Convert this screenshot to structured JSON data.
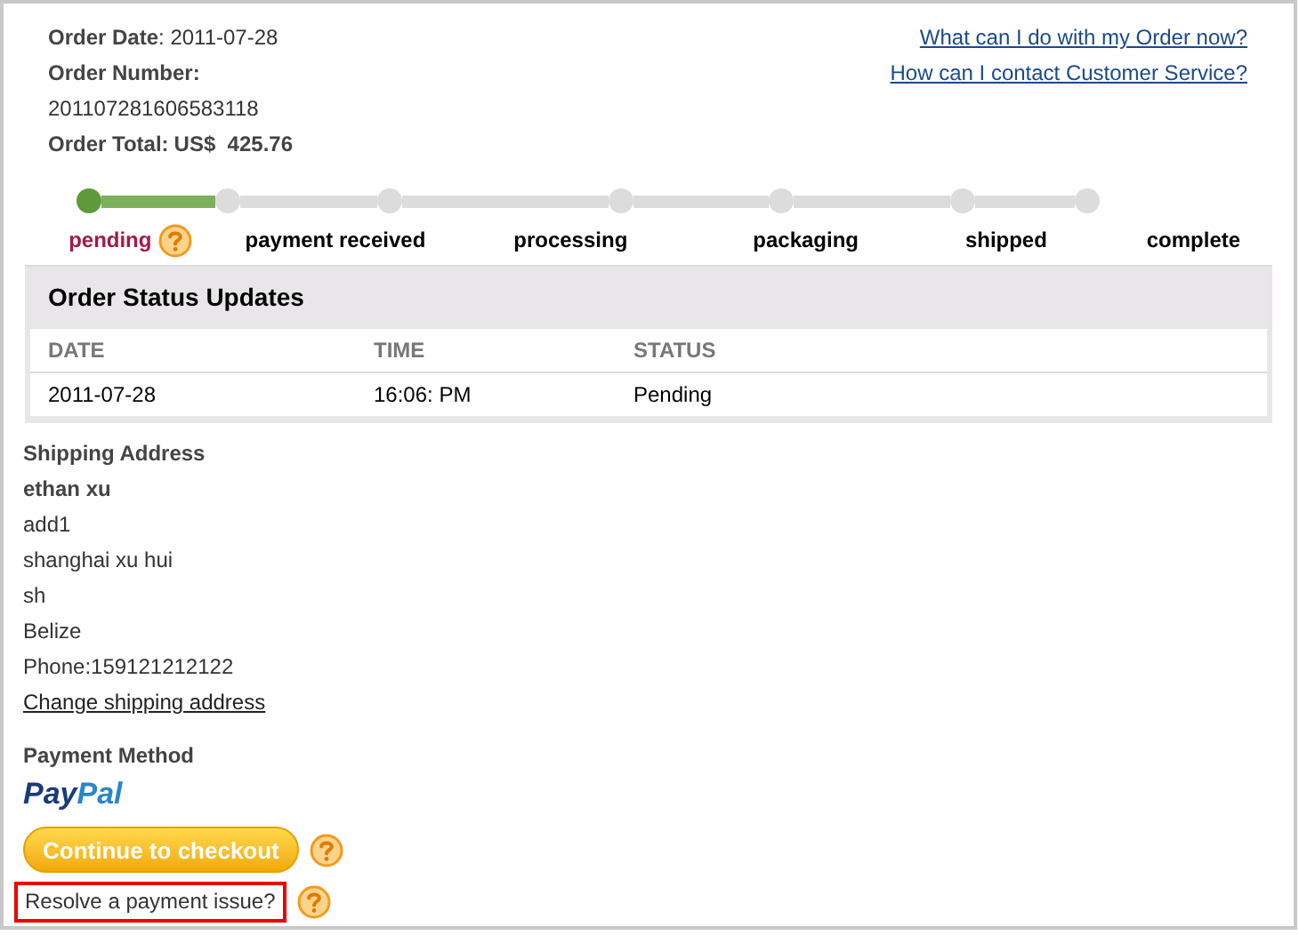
{
  "order": {
    "date_label": "Order Date",
    "date": ": 2011-07-28",
    "number_label": "Order Number:",
    "number": "201107281606583118",
    "total_label": "Order Total:",
    "total": "US$  425.76"
  },
  "links": [
    "What can I do with my Order now?",
    "How can I contact Customer Service?"
  ],
  "progress": {
    "nodes": [
      {
        "reached": true
      },
      {
        "reached": false
      },
      {
        "reached": false
      },
      {
        "reached": false
      },
      {
        "reached": false
      },
      {
        "reached": false
      },
      {
        "reached": false
      }
    ],
    "labels": [
      {
        "text": "pending",
        "current": true,
        "help": true
      },
      {
        "text": "payment received",
        "current": false,
        "help": false
      },
      {
        "text": "processing",
        "current": false,
        "help": false
      },
      {
        "text": "packaging",
        "current": false,
        "help": false
      },
      {
        "text": "shipped",
        "current": false,
        "help": false
      },
      {
        "text": "complete",
        "current": false,
        "help": false
      }
    ]
  },
  "status_updates": {
    "title": "Order Status Updates",
    "columns": [
      "DATE",
      "TIME",
      "STATUS"
    ],
    "rows": [
      [
        "2011-07-28",
        "16:06: PM",
        "Pending"
      ]
    ]
  },
  "shipping": {
    "title": "Shipping Address",
    "name": "ethan xu",
    "lines": [
      "add1",
      "shanghai xu hui",
      "sh",
      "Belize",
      "Phone:159121212122"
    ],
    "change_link": "Change shipping address"
  },
  "payment": {
    "title": "Payment Method",
    "logo": "PayPal",
    "checkout_button": "Continue to checkout",
    "resolve_link": "Resolve a payment issue?"
  }
}
